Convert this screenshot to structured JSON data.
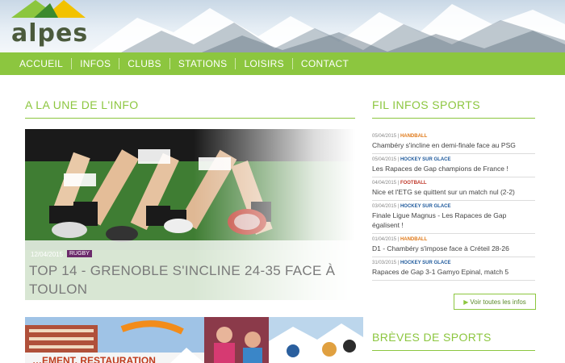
{
  "site": {
    "logo_text": "alpes"
  },
  "nav": {
    "items": [
      {
        "label": "ACCUEIL"
      },
      {
        "label": "INFOS"
      },
      {
        "label": "CLUBS"
      },
      {
        "label": "STATIONS"
      },
      {
        "label": "LOISIRS"
      },
      {
        "label": "CONTACT"
      }
    ]
  },
  "main": {
    "section_title": "A LA UNE DE L'INFO",
    "featured": {
      "date": "12/04/2015",
      "tag": "RUGBY",
      "title": "TOP 14 - GRENOBLE S'INCLINE 24-35 FACE À TOULON"
    },
    "thumbnail_text": "…EMENT, RESTAURATION"
  },
  "sidebar": {
    "fil_title": "FIL INFOS SPORTS",
    "news": [
      {
        "date": "05/04/2015",
        "category": "HANDBALL",
        "cat_color": "#e07a1a",
        "title": "Chambéry s'incline en demi-finale face au PSG"
      },
      {
        "date": "05/04/2015",
        "category": "HOCKEY SUR GLACE",
        "cat_color": "#1f5a9c",
        "title": "Les Rapaces de Gap champions de France !"
      },
      {
        "date": "04/04/2015",
        "category": "FOOTBALL",
        "cat_color": "#c0392b",
        "title": "Nice et l'ETG se quittent sur un match nul (2-2)"
      },
      {
        "date": "03/04/2015",
        "category": "HOCKEY SUR GLACE",
        "cat_color": "#1f5a9c",
        "title": "Finale Ligue Magnus - Les Rapaces de Gap égalisent !"
      },
      {
        "date": "01/04/2015",
        "category": "HANDBALL",
        "cat_color": "#e07a1a",
        "title": "D1 - Chambéry s'impose face à Créteil 28-26"
      },
      {
        "date": "31/03/2015",
        "category": "HOCKEY SUR GLACE",
        "cat_color": "#1f5a9c",
        "title": "Rapaces de Gap 3-1 Gamyo Epinal, match 5"
      }
    ],
    "more_label": "Voir toutes les infos",
    "breves_title": "BRÈVES DE SPORTS"
  },
  "colors": {
    "accent": "#8cc63f"
  }
}
